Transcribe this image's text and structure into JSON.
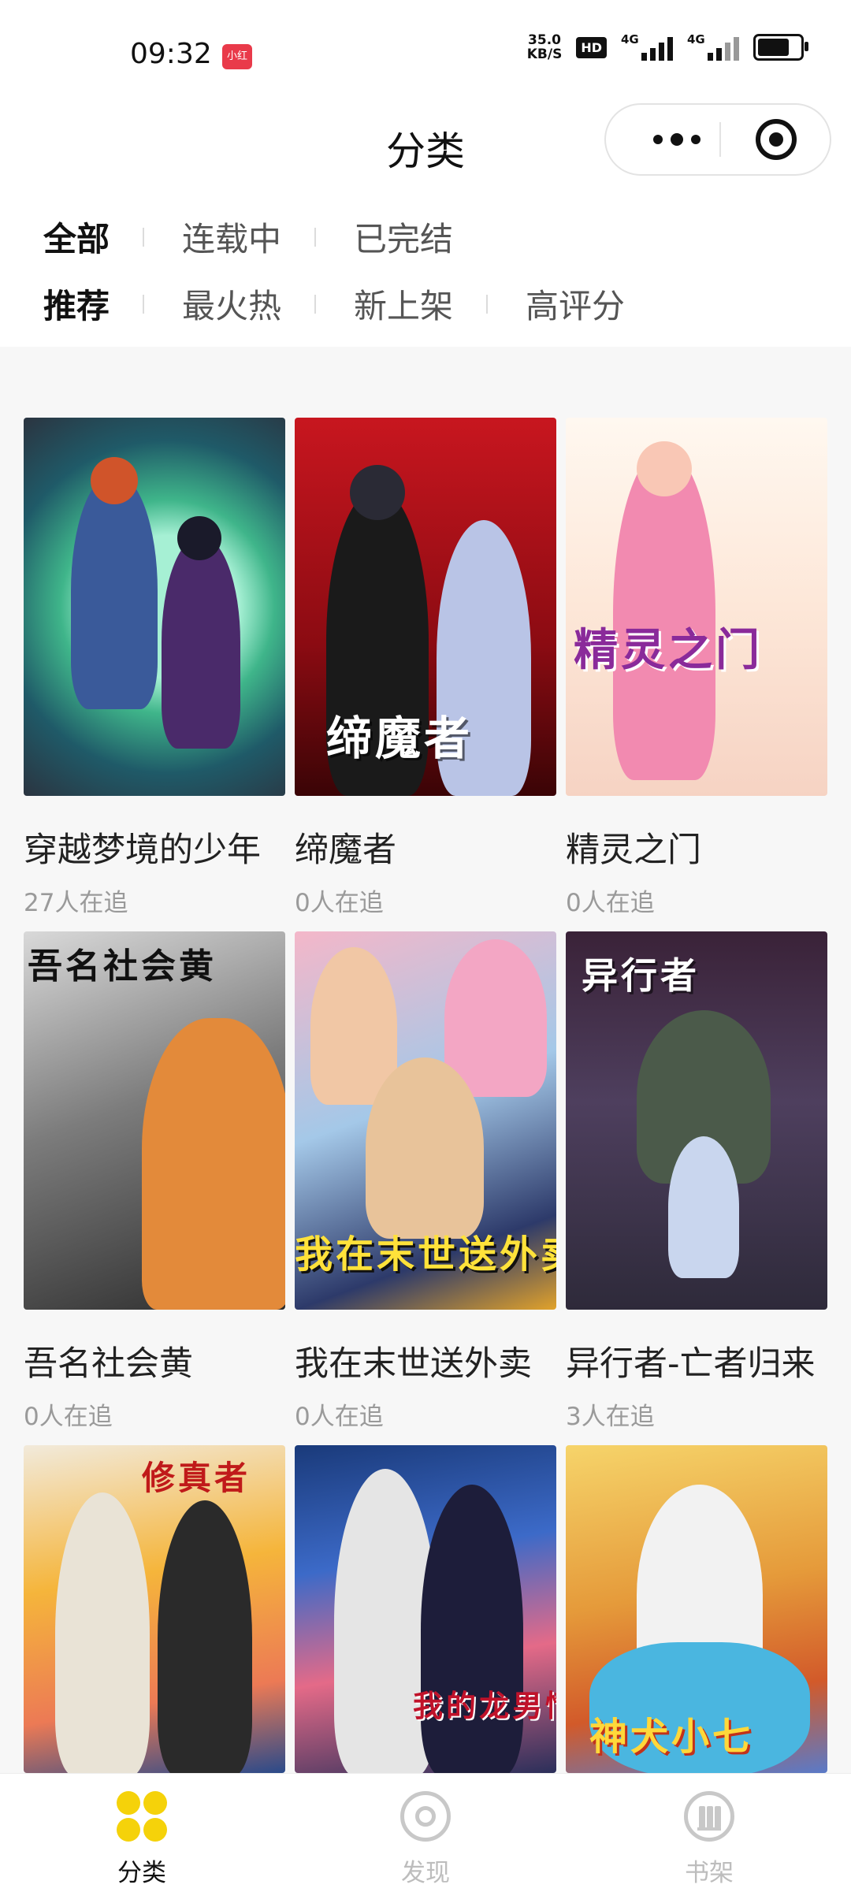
{
  "status_bar": {
    "time": "09:32",
    "app_badge": "小红书",
    "net_speed_value": "35.0",
    "net_speed_unit": "KB/S",
    "hd_label": "HD",
    "signal1_label": "4G",
    "signal2_label": "4G"
  },
  "nav": {
    "title": "分类"
  },
  "filters": {
    "status": [
      "全部",
      "连载中",
      "已完结"
    ],
    "sort": [
      "推荐",
      "最火热",
      "新上架",
      "高评分"
    ],
    "status_selected": "全部",
    "sort_selected": "推荐"
  },
  "comics": [
    {
      "title": "穿越梦境的少年",
      "followers": "27人在追",
      "cover_text": ""
    },
    {
      "title": "缔魔者",
      "followers": "0人在追",
      "cover_text": "缔魔者"
    },
    {
      "title": "精灵之门",
      "followers": "0人在追",
      "cover_text": "精灵之门"
    },
    {
      "title": "吾名社会黄",
      "followers": "0人在追",
      "cover_text": "吾名社会黄"
    },
    {
      "title": "我在末世送外卖",
      "followers": "0人在追",
      "cover_text": "我在末世送外卖"
    },
    {
      "title": "异行者-亡者归来",
      "followers": "3人在追",
      "cover_text": "异行者"
    },
    {
      "title": "",
      "followers": "",
      "cover_text": "修真者"
    },
    {
      "title": "",
      "followers": "",
      "cover_text": "我的龙男情"
    },
    {
      "title": "",
      "followers": "",
      "cover_text": "神犬小七"
    }
  ],
  "tabs": [
    {
      "label": "分类",
      "icon": "category-grid-icon"
    },
    {
      "label": "发现",
      "icon": "discover-target-icon"
    },
    {
      "label": "书架",
      "icon": "bookshelf-icon"
    }
  ],
  "colors": {
    "active_text": "#111111",
    "inactive_text": "#555555",
    "muted_text": "#9a9a9a",
    "tab_active_icon": "#f5d20a",
    "tab_inactive": "#bdbdbd",
    "badge_red": "#e93a4a"
  }
}
